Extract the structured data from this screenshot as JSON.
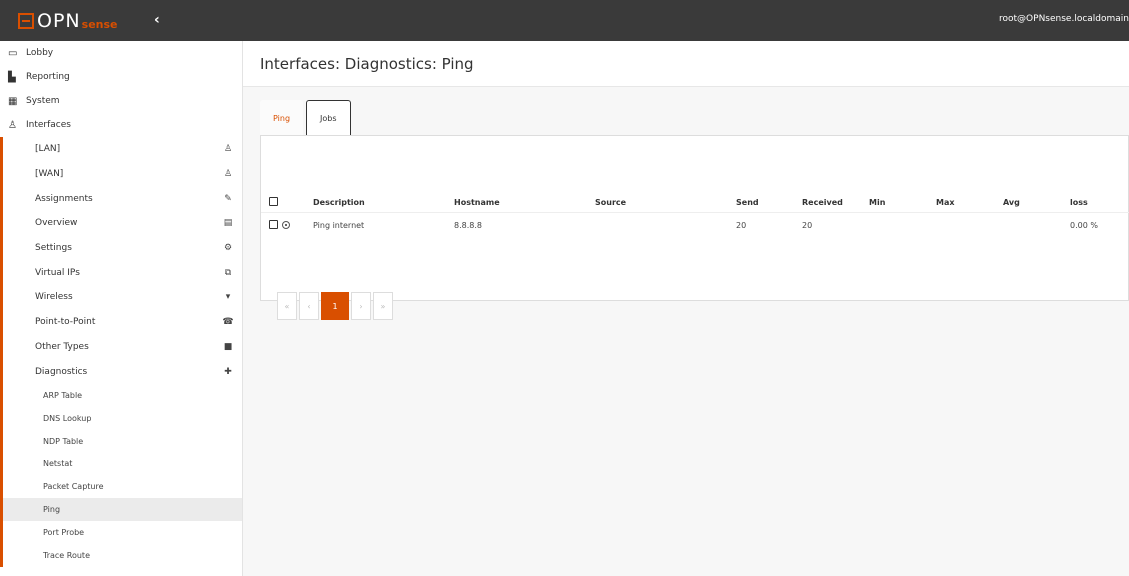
{
  "brand": {
    "name_main": "OPN",
    "name_sub": "sense",
    "accent": "#d94f00"
  },
  "header": {
    "user": "root@OPNsense.localdomain"
  },
  "sidebar": {
    "top": [
      {
        "label": "Lobby",
        "icon": "laptop-icon"
      },
      {
        "label": "Reporting",
        "icon": "chart-icon"
      },
      {
        "label": "System",
        "icon": "system-icon"
      },
      {
        "label": "Interfaces",
        "icon": "network-icon"
      }
    ],
    "interfaces": [
      {
        "label": "[LAN]",
        "icon": "network-icon"
      },
      {
        "label": "[WAN]",
        "icon": "network-icon"
      },
      {
        "label": "Assignments",
        "icon": "pencil-icon"
      },
      {
        "label": "Overview",
        "icon": "list-icon"
      },
      {
        "label": "Settings",
        "icon": "gears-icon"
      },
      {
        "label": "Virtual IPs",
        "icon": "copy-icon"
      },
      {
        "label": "Wireless",
        "icon": "wifi-icon"
      },
      {
        "label": "Point-to-Point",
        "icon": "phone-icon"
      },
      {
        "label": "Other Types",
        "icon": "archive-icon"
      },
      {
        "label": "Diagnostics",
        "icon": "medkit-icon"
      }
    ],
    "diagnostics": [
      {
        "label": "ARP Table"
      },
      {
        "label": "DNS Lookup"
      },
      {
        "label": "NDP Table"
      },
      {
        "label": "Netstat"
      },
      {
        "label": "Packet Capture"
      },
      {
        "label": "Ping",
        "active": true
      },
      {
        "label": "Port Probe"
      },
      {
        "label": "Trace Route"
      }
    ]
  },
  "page": {
    "title": "Interfaces: Diagnostics: Ping"
  },
  "tabs": [
    {
      "label": "Ping",
      "active": true
    },
    {
      "label": "Jobs",
      "active": false
    }
  ],
  "table": {
    "headers": [
      "Description",
      "Hostname",
      "Source",
      "Send",
      "Received",
      "Min",
      "Max",
      "Avg",
      "loss"
    ],
    "rows": [
      {
        "description": "Ping internet",
        "hostname": "8.8.8.8",
        "source": "",
        "send": "20",
        "received": "20",
        "min": "",
        "max": "",
        "avg": "",
        "loss": "0.00 %"
      }
    ]
  },
  "pager": {
    "first": "«",
    "prev": "‹",
    "current": "1",
    "next": "›",
    "last": "»"
  }
}
